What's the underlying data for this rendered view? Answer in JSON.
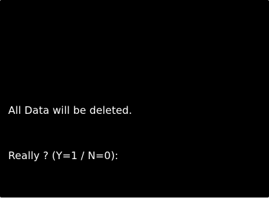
{
  "console": {
    "lines": [
      "All Data will be deleted.",
      "Really ? (Y=1 / N=0):"
    ]
  },
  "colors": {
    "background": "#000000",
    "text": "#ffffff"
  }
}
